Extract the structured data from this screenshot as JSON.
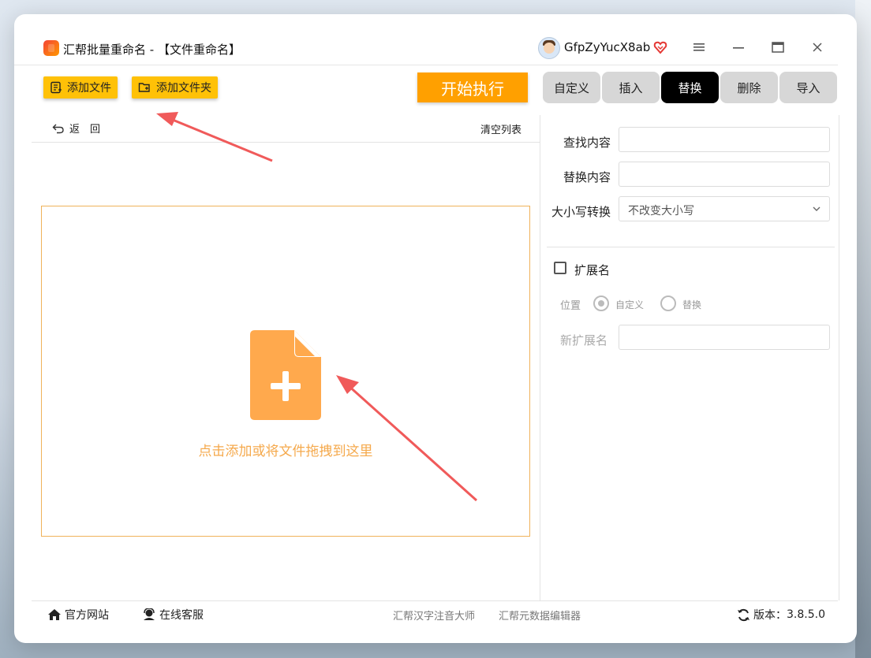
{
  "window": {
    "title": "汇帮批量重命名 - 【文件重命名】"
  },
  "user": {
    "name": "GfpZyYucX8ab"
  },
  "toolbar": {
    "add_file": "添加文件",
    "add_folder": "添加文件夹",
    "start": "开始执行"
  },
  "tabs": [
    {
      "label": "自定义",
      "active": false
    },
    {
      "label": "插入",
      "active": false
    },
    {
      "label": "替换",
      "active": true
    },
    {
      "label": "删除",
      "active": false
    },
    {
      "label": "导入",
      "active": false
    }
  ],
  "list": {
    "back": "返　回",
    "clear": "清空列表",
    "drop_hint": "点击添加或将文件拖拽到这里"
  },
  "replace_form": {
    "find_label": "查找内容",
    "find_value": "",
    "replace_label": "替换内容",
    "replace_value": "",
    "case_label": "大小写转换",
    "case_value": "不改变大小写",
    "ext_label": "扩展名",
    "ext_checked": false,
    "position_label": "位置",
    "position_options": [
      "自定义",
      "替换"
    ],
    "position_selected": "自定义",
    "new_ext_label": "新扩展名",
    "new_ext_value": ""
  },
  "footer": {
    "website": "官方网站",
    "support": "在线客服",
    "link1": "汇帮汉字注音大师",
    "link2": "汇帮元数据编辑器",
    "version_label": "版本：",
    "version": "3.8.5.0"
  },
  "colors": {
    "accent": "#ffa000",
    "yellow": "#ffc107",
    "drop_border": "#f0b25a",
    "file_icon": "#ffa94d"
  }
}
